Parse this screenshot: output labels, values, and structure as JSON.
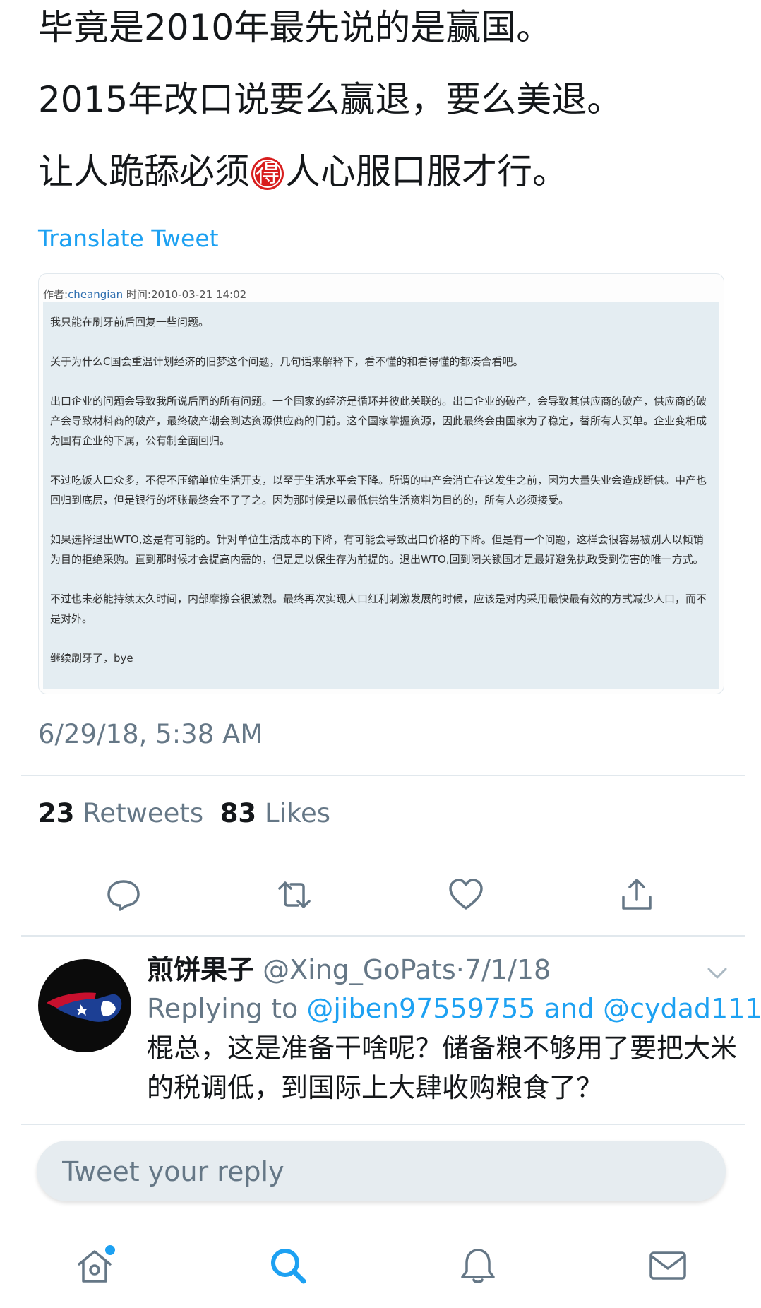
{
  "tweet": {
    "line1": "毕竟是2010年最先说的是赢国。",
    "line2": "2015年改口说要么赢退，要么美退。",
    "line3_before": "让人跪舔必须",
    "line3_badge": "得",
    "line3_after": "人心服口服才行。",
    "translate_label": "Translate Tweet",
    "timestamp": "6/29/18, 5:38 AM",
    "retweets_count": "23",
    "retweets_label": "Retweets",
    "likes_count": "83",
    "likes_label": "Likes"
  },
  "quoted_post": {
    "author_label": "作者:",
    "author": "cheangian",
    "time_label": "时间:",
    "time": "2010-03-21 14:02",
    "paragraphs": [
      "我只能在刷牙前后回复一些问题。",
      "关于为什么C国会重温计划经济的旧梦这个问题，几句话来解释下，看不懂的和看得懂的都凑合看吧。",
      "出口企业的问题会导致我所说后面的所有问题。一个国家的经济是循环并彼此关联的。出口企业的破产，会导致其供应商的破产，供应商的破产会导致材料商的破产，最终破产潮会到达资源供应商的门前。这个国家掌握资源，因此最终会由国家为了稳定，替所有人买单。企业变相成为国有企业的下属，公有制全面回归。",
      "不过吃饭人口众多，不得不压缩单位生活开支，以至于生活水平会下降。所谓的中产会消亡在这发生之前，因为大量失业会造成断供。中产也回归到底层，但是银行的坏账最终会不了了之。因为那时候是以最低供给生活资料为目的的，所有人必须接受。",
      "如果选择退出WTO,这是有可能的。针对单位生活成本的下降，有可能会导致出口价格的下降。但是有一个问题，这样会很容易被别人以倾销为目的拒绝采购。直到那时候才会提高内需的，但是是以保生存为前提的。退出WTO,回到闭关锁国才是最好避免执政受到伤害的唯一方式。",
      "不过也未必能持续太久时间，内部摩擦会很激烈。最终再次实现人口红利刺激发展的时候，应该是对内采用最快最有效的方式减少人口，而不是对外。",
      "继续刷牙了，bye"
    ]
  },
  "actions": [
    "reply-icon",
    "retweet-icon",
    "like-icon",
    "share-icon"
  ],
  "reply": {
    "name": "煎饼果子",
    "handle": "@Xing_GoPats",
    "separator": "·",
    "date": "7/1/18",
    "replying_to_label": "Replying to",
    "mention1": "@jiben97559755",
    "and_label": "and",
    "mention2": "@cydad111",
    "text": "棍总，这是准备干啥呢？储备粮不够用了要把大米的税调低，到国际上大肆收购粮食了？"
  },
  "reply_box": {
    "placeholder": "Tweet your reply"
  },
  "bottom_nav": [
    "home-icon",
    "search-icon",
    "notifications-icon",
    "messages-icon"
  ],
  "colors": {
    "accent": "#1da1f2",
    "text": "#14171a",
    "muted": "#657786",
    "divider": "#e1e8ed",
    "badge": "#d81e1e"
  }
}
